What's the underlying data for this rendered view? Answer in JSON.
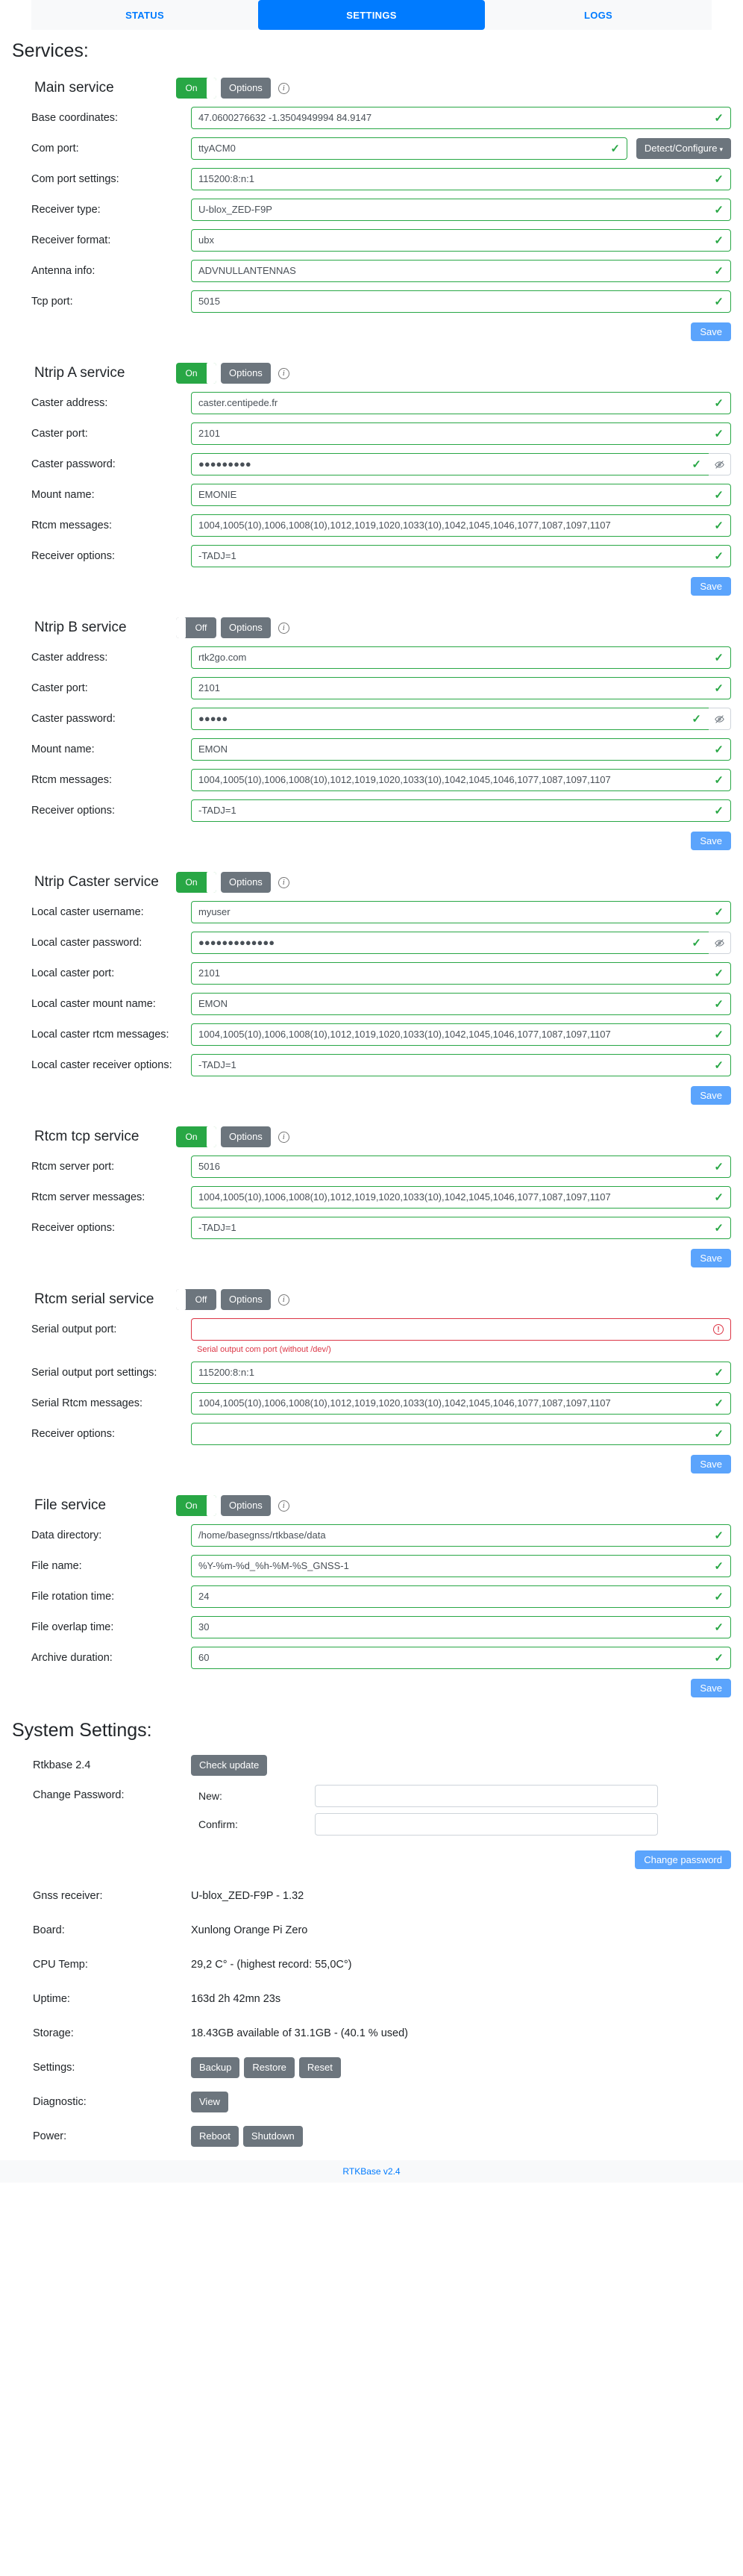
{
  "tabs": [
    {
      "label": "STATUS",
      "active": false
    },
    {
      "label": "SETTINGS",
      "active": true
    },
    {
      "label": "LOGS",
      "active": false
    }
  ],
  "headings": {
    "services": "Services:",
    "system_settings": "System Settings:"
  },
  "common": {
    "options_label": "Options",
    "save_label": "Save",
    "on_label": "On",
    "off_label": "Off",
    "info_glyph": "i",
    "tick_glyph": "✓",
    "error_glyph": "!",
    "eye_glyph": "◎",
    "caret_glyph": "▾"
  },
  "colors": {
    "accent_blue": "#007bff",
    "save_blue": "#5ba4fc",
    "toggle_on_green": "#28a745",
    "toggle_off_grey": "#6c757d",
    "valid_green": "#28a745",
    "error_red": "#dc3545"
  },
  "main_service": {
    "title": "Main service",
    "toggle": "On",
    "fields": [
      {
        "label": "Base coordinates:",
        "value": "47.0600276632 -1.3504949994 84.9147",
        "state": "valid"
      },
      {
        "label": "Com port:",
        "value": "ttyACM0",
        "state": "valid",
        "extra_button": "Detect/Configure"
      },
      {
        "label": "Com port settings:",
        "value": "115200:8:n:1",
        "state": "valid"
      },
      {
        "label": "Receiver type:",
        "value": "U-blox_ZED-F9P",
        "state": "valid"
      },
      {
        "label": "Receiver format:",
        "value": "ubx",
        "state": "valid"
      },
      {
        "label": "Antenna info:",
        "value": "ADVNULLANTENNAS",
        "state": "valid"
      },
      {
        "label": "Tcp port:",
        "value": "5015",
        "state": "valid"
      }
    ]
  },
  "ntrip_a": {
    "title": "Ntrip A service",
    "toggle": "On",
    "fields": [
      {
        "label": "Caster address:",
        "value": "caster.centipede.fr",
        "state": "valid"
      },
      {
        "label": "Caster port:",
        "value": "2101",
        "state": "valid"
      },
      {
        "label": "Caster password:",
        "value": "●●●●●●●●●",
        "state": "valid",
        "password": true
      },
      {
        "label": "Mount name:",
        "value": "EMONIE",
        "state": "valid"
      },
      {
        "label": "Rtcm messages:",
        "value": "1004,1005(10),1006,1008(10),1012,1019,1020,1033(10),1042,1045,1046,1077,1087,1097,1107",
        "state": "valid"
      },
      {
        "label": "Receiver options:",
        "value": "-TADJ=1",
        "state": "valid"
      }
    ]
  },
  "ntrip_b": {
    "title": "Ntrip B service",
    "toggle": "Off",
    "fields": [
      {
        "label": "Caster address:",
        "value": "rtk2go.com",
        "state": "valid"
      },
      {
        "label": "Caster port:",
        "value": "2101",
        "state": "valid"
      },
      {
        "label": "Caster password:",
        "value": "●●●●●",
        "state": "valid",
        "password": true
      },
      {
        "label": "Mount name:",
        "value": "EMON",
        "state": "valid"
      },
      {
        "label": "Rtcm messages:",
        "value": "1004,1005(10),1006,1008(10),1012,1019,1020,1033(10),1042,1045,1046,1077,1087,1097,1107",
        "state": "valid"
      },
      {
        "label": "Receiver options:",
        "value": "-TADJ=1",
        "state": "valid"
      }
    ]
  },
  "ntrip_caster": {
    "title": "Ntrip Caster service",
    "toggle": "On",
    "fields": [
      {
        "label": "Local caster username:",
        "value": "myuser",
        "state": "valid"
      },
      {
        "label": "Local caster password:",
        "value": "●●●●●●●●●●●●●",
        "state": "valid",
        "password": true
      },
      {
        "label": "Local caster port:",
        "value": "2101",
        "state": "valid"
      },
      {
        "label": "Local caster mount name:",
        "value": "EMON",
        "state": "valid"
      },
      {
        "label": "Local caster rtcm messages:",
        "value": "1004,1005(10),1006,1008(10),1012,1019,1020,1033(10),1042,1045,1046,1077,1087,1097,1107",
        "state": "valid"
      },
      {
        "label": "Local caster receiver options:",
        "value": "-TADJ=1",
        "state": "valid"
      }
    ]
  },
  "rtcm_tcp": {
    "title": "Rtcm tcp service",
    "toggle": "On",
    "fields": [
      {
        "label": "Rtcm server port:",
        "value": "5016",
        "state": "valid"
      },
      {
        "label": "Rtcm server messages:",
        "value": "1004,1005(10),1006,1008(10),1012,1019,1020,1033(10),1042,1045,1046,1077,1087,1097,1107",
        "state": "valid"
      },
      {
        "label": "Receiver options:",
        "value": "-TADJ=1",
        "state": "valid"
      }
    ]
  },
  "rtcm_serial": {
    "title": "Rtcm serial service",
    "toggle": "Off",
    "fields": [
      {
        "label": "Serial output port:",
        "value": "",
        "state": "error",
        "hint": "Serial output com port (without /dev/)"
      },
      {
        "label": "Serial output port settings:",
        "value": "115200:8:n:1",
        "state": "valid"
      },
      {
        "label": "Serial Rtcm messages:",
        "value": "1004,1005(10),1006,1008(10),1012,1019,1020,1033(10),1042,1045,1046,1077,1087,1097,1107",
        "state": "valid"
      },
      {
        "label": "Receiver options:",
        "value": "",
        "state": "valid"
      }
    ]
  },
  "file_service": {
    "title": "File service",
    "toggle": "On",
    "fields": [
      {
        "label": "Data directory:",
        "value": "/home/basegnss/rtkbase/data",
        "state": "valid"
      },
      {
        "label": "File name:",
        "value": "%Y-%m-%d_%h-%M-%S_GNSS-1",
        "state": "valid"
      },
      {
        "label": "File rotation time:",
        "value": "24",
        "state": "valid"
      },
      {
        "label": "File overlap time:",
        "value": "30",
        "state": "valid"
      },
      {
        "label": "Archive duration:",
        "value": "60",
        "state": "valid"
      }
    ]
  },
  "system": {
    "version_label": "Rtkbase 2.4",
    "check_update_label": "Check update",
    "change_password_label": "Change Password:",
    "new_label": "New:",
    "confirm_label": "Confirm:",
    "new_value": "",
    "confirm_value": "",
    "change_password_button": "Change password",
    "info_rows": [
      {
        "label": "Gnss receiver:",
        "value": "U-blox_ZED-F9P - 1.32"
      },
      {
        "label": "Board:",
        "value": "Xunlong Orange Pi Zero"
      },
      {
        "label": "CPU Temp:",
        "value": "29,2 C° - (highest record: 55,0C°)"
      },
      {
        "label": "Uptime:",
        "value": "163d 2h 42mn 23s"
      },
      {
        "label": "Storage:",
        "value": "18.43GB available of 31.1GB - (40.1 % used)"
      }
    ],
    "settings_label": "Settings:",
    "settings_buttons": [
      "Backup",
      "Restore",
      "Reset"
    ],
    "diagnostic_label": "Diagnostic:",
    "diagnostic_buttons": [
      "View"
    ],
    "power_label": "Power:",
    "power_buttons": [
      "Reboot",
      "Shutdown"
    ]
  },
  "footer": {
    "text": "RTKBase v2.4"
  }
}
